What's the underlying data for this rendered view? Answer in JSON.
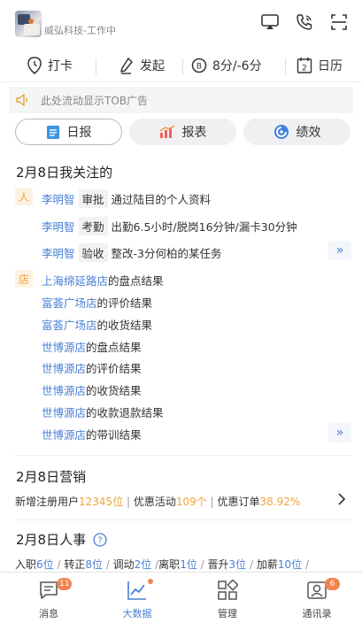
{
  "header": {
    "company": "威弘科技-工作中"
  },
  "actions": [
    {
      "label": "打卡"
    },
    {
      "label": "发起"
    },
    {
      "label": "8分/-6分"
    },
    {
      "label": "日历",
      "icon_number": "2"
    }
  ],
  "ad": {
    "text": "此处流动显示TOB广告"
  },
  "tabs": [
    {
      "label": "日报",
      "active": true
    },
    {
      "label": "报表"
    },
    {
      "label": "绩效"
    }
  ],
  "focus": {
    "title": "2月8日我关注的",
    "people_tag": "人",
    "people": [
      {
        "name": "李明智",
        "type": "审批",
        "text": "通过陆目的个人资料"
      },
      {
        "name": "李明智",
        "type": "考勤",
        "text": "出勤6.5小时/脱岗16分钟/漏卡30分钟"
      },
      {
        "name": "李明智",
        "type": "验收",
        "text": "整改-3分何柏的某任务"
      }
    ],
    "store_tag": "店",
    "stores": [
      {
        "store": "上海绵延路店",
        "suffix": "的盘点结果"
      },
      {
        "store": "富荟广场店",
        "suffix": "的评价结果"
      },
      {
        "store": "富荟广场店",
        "suffix": "的收货结果"
      },
      {
        "store": "世博源店",
        "suffix": "的盘点结果"
      },
      {
        "store": "世博源店",
        "suffix": "的评价结果"
      },
      {
        "store": "世博源店",
        "suffix": "的收货结果"
      },
      {
        "store": "世博源店",
        "suffix": "的收款退款结果"
      },
      {
        "store": "世博源店",
        "suffix": "的带训结果"
      }
    ],
    "more": "»"
  },
  "marketing": {
    "title": "2月8日营销",
    "s1_label": "新增注册用户",
    "s1_value": "12345位",
    "s2_label": "优惠活动",
    "s2_value": "109个",
    "s3_label": "优惠订单",
    "s3_value": "38.92%"
  },
  "hr": {
    "title": "2月8日人事",
    "items": [
      {
        "label": "入职",
        "value": "6位"
      },
      {
        "label": "转正",
        "value": "8位"
      },
      {
        "label": "调动",
        "value": "2位"
      },
      {
        "label": "离职",
        "value": "1位"
      },
      {
        "label": "晋升",
        "value": "3位"
      },
      {
        "label": "加薪",
        "value": "10位"
      }
    ]
  },
  "nav": [
    {
      "label": "消息",
      "badge": "11"
    },
    {
      "label": "大数据",
      "active": true
    },
    {
      "label": "管理"
    },
    {
      "label": "通讯录",
      "badge": "6"
    }
  ],
  "colors": {
    "accent": "#4a7fd4",
    "highlight": "#f2a33a",
    "badge": "#f2844e"
  }
}
